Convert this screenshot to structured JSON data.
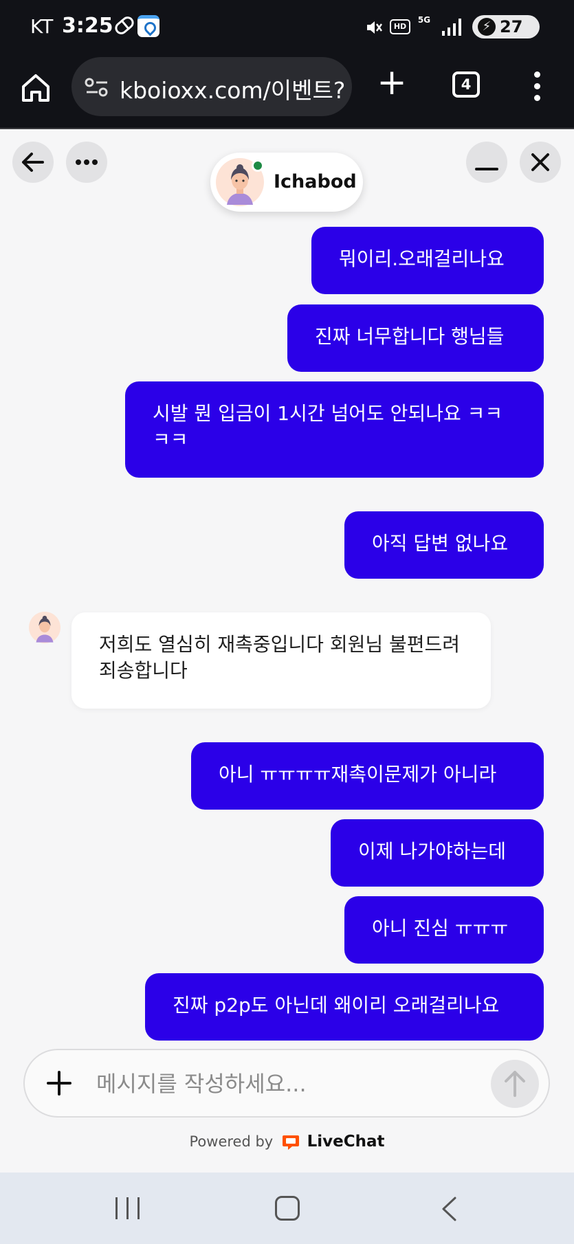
{
  "status_bar": {
    "carrier": "KT",
    "time": "3:25",
    "hd": "HD",
    "network": "5G",
    "battery": "27"
  },
  "browser": {
    "url": "kboioxx.com/이벤트?a",
    "tab_count": "4"
  },
  "chat": {
    "agent_name": "Ichabod",
    "agent_status": "online",
    "accent_color": "#2b00e8",
    "messages": [
      {
        "from": "visitor",
        "text": "뭐이리.오래걸리나요"
      },
      {
        "from": "visitor",
        "text": "진짜 너무합니다 행님들"
      },
      {
        "from": "visitor",
        "text": "시발 뭔 입금이 1시간 넘어도 안되나요 ㅋㅋㅋㅋ"
      },
      {
        "from": "visitor",
        "text": "아직 답변 없나요"
      },
      {
        "from": "agent",
        "text": "저희도 열심히 재촉중입니다 회원님 불편드려 죄송합니다"
      },
      {
        "from": "visitor",
        "text": "아니 ㅠㅠㅠㅠ재촉이문제가 아니라"
      },
      {
        "from": "visitor",
        "text": "이제 나가야하는데"
      },
      {
        "from": "visitor",
        "text": "아니 진심 ㅠㅠㅠ"
      },
      {
        "from": "visitor",
        "text": "진짜 p2p도 아닌데 왜이리 오래걸리나요"
      }
    ]
  },
  "composer": {
    "placeholder": "메시지를 작성하세요...",
    "value": ""
  },
  "footer": {
    "powered_by": "Powered by",
    "brand": "LiveChat",
    "brand_color": "#ff5100"
  },
  "icons": {
    "back": "arrow-left-icon",
    "more": "ellipsis-icon",
    "minimize": "minimize-icon",
    "close": "close-icon",
    "send": "arrow-up-icon",
    "attach": "plus-icon"
  }
}
